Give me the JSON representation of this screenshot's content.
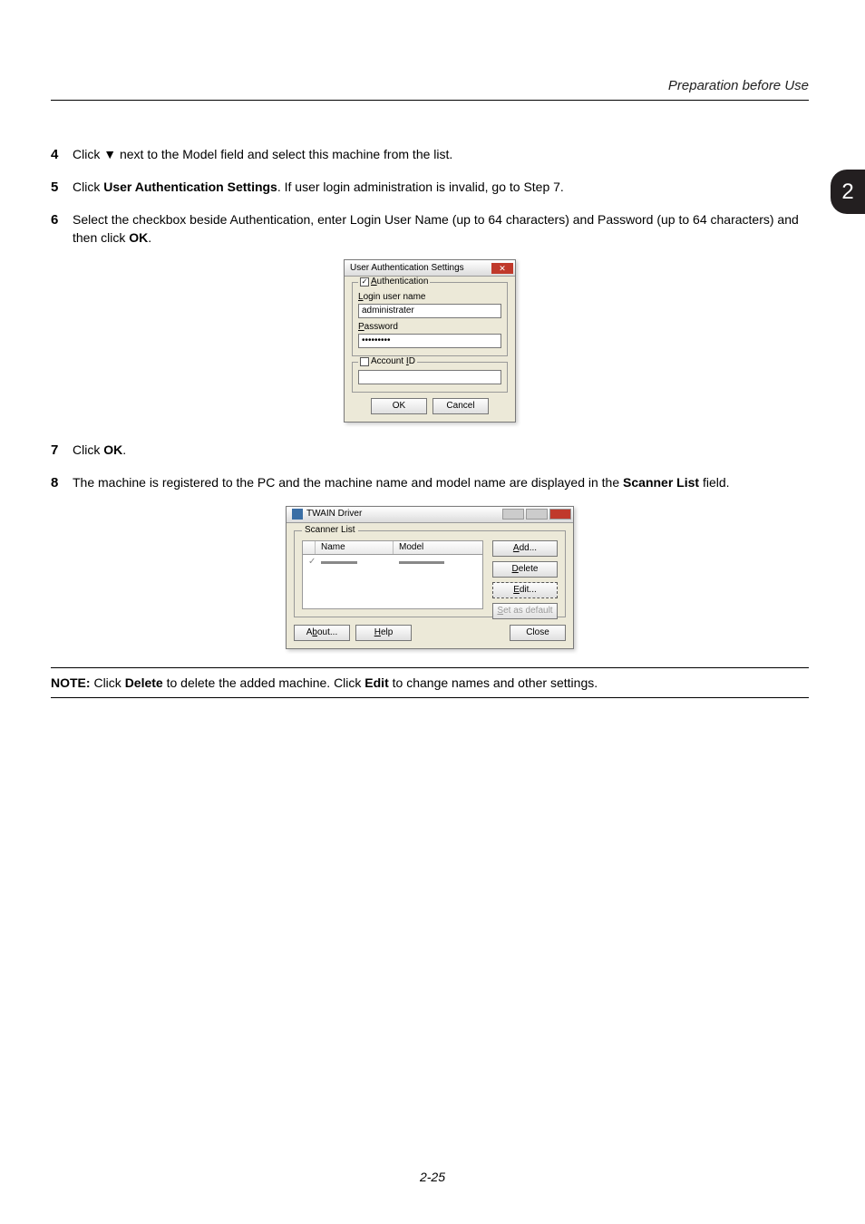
{
  "header_title": "Preparation before Use",
  "tab_number": "2",
  "steps": {
    "s4_num": "4",
    "s4_a": "Click ",
    "s4_tri": "▼",
    "s4_b": " next to the Model field and select this machine from the list.",
    "s5_num": "5",
    "s5_a": "Click ",
    "s5_bold": "User Authentication Settings",
    "s5_b": ". If user login administration is invalid, go to Step 7.",
    "s6_num": "6",
    "s6_a": "Select the checkbox beside Authentication, enter Login User Name (up to 64 characters) and Password (up to 64 characters) and then click ",
    "s6_bold": "OK",
    "s6_b": ".",
    "s7_num": "7",
    "s7_a": "Click ",
    "s7_bold": "OK",
    "s7_b": ".",
    "s8_num": "8",
    "s8_a": "The machine is registered to the PC and the machine name and model name are displayed in the ",
    "s8_bold": "Scanner List",
    "s8_b": " field."
  },
  "dlg1": {
    "title": "User Authentication Settings",
    "authentication_label": "Authentication",
    "auth_checked": "✓",
    "login_label": "Login user name",
    "login_value": "administrater",
    "password_label": "Password",
    "password_value": "•••••••••",
    "account_label": "Account ID",
    "account_checked": "",
    "account_value": "",
    "ok": "OK",
    "cancel": "Cancel"
  },
  "dlg2": {
    "title_suffix": "TWAIN Driver",
    "scanner_list": "Scanner List",
    "col_name": "Name",
    "col_model": "Model",
    "row_check": "✓",
    "add": "Add...",
    "delete": "Delete",
    "edit": "Edit...",
    "set_default": "Set as default",
    "about": "About...",
    "help": "Help",
    "close": "Close"
  },
  "note": {
    "prefix": "NOTE: ",
    "a": "Click ",
    "delete": "Delete",
    "b": " to delete the added machine. Click ",
    "edit": "Edit",
    "c": " to change names and other settings."
  },
  "footer": "2-25"
}
